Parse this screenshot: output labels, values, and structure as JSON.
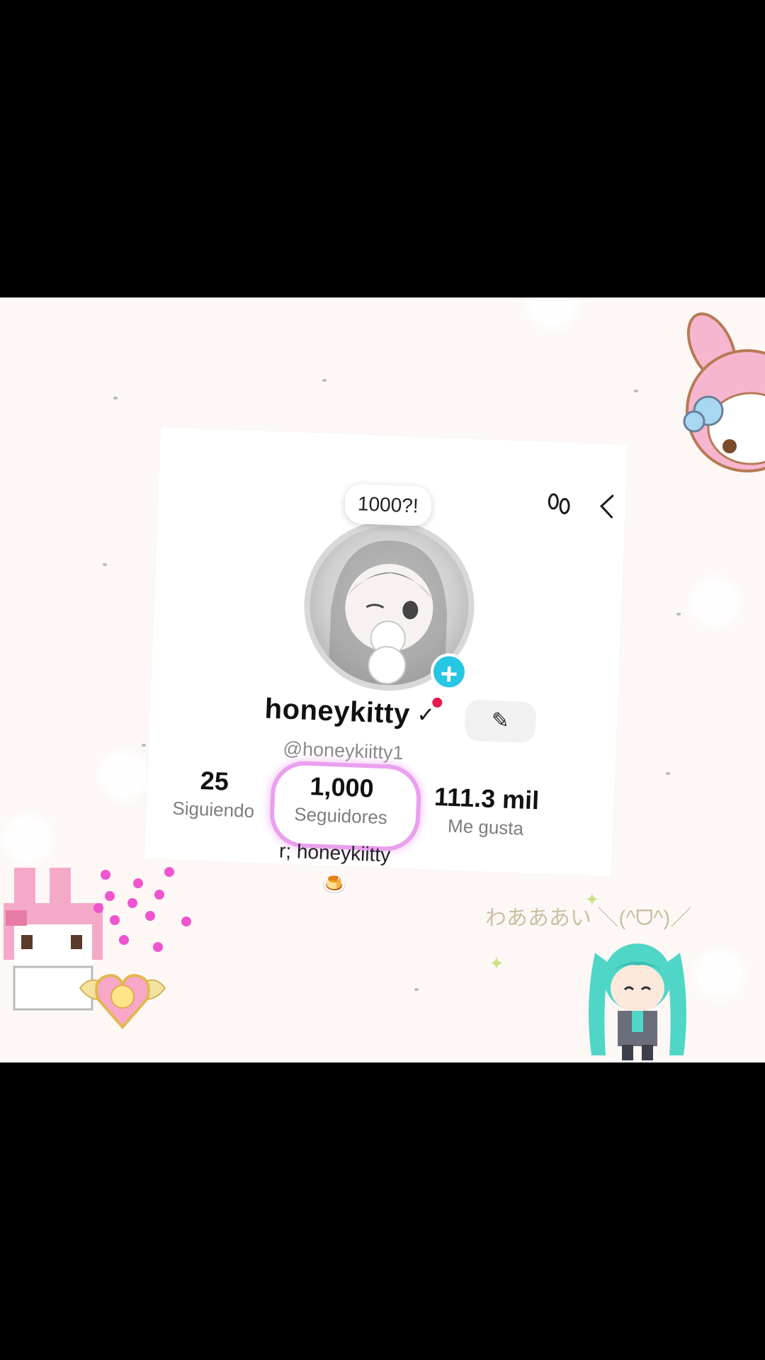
{
  "profile": {
    "bubble_text": "1000?!",
    "display_name": "honeykitty",
    "handle": "@honeykiitty1",
    "bio": "r; honeykiitty",
    "bio_emoji": "🍮",
    "stats": [
      {
        "value": "25",
        "label": "Siguiendo"
      },
      {
        "value": "1,000",
        "label": "Seguidores"
      },
      {
        "value": "111.3 mil",
        "label": "Me gusta"
      }
    ]
  },
  "icons": {
    "footprints": "footprints-icon",
    "share": "share-icon",
    "edit": "pencil-icon",
    "add": "plus-icon",
    "chevron": "chevron-down-icon"
  },
  "stickers": {
    "miku_caption": "わあああい ＼(^ᗜ^)／"
  },
  "colors": {
    "accent": "#26c6e4",
    "highlight": "#eaa0ee",
    "notification": "#e8194a"
  }
}
